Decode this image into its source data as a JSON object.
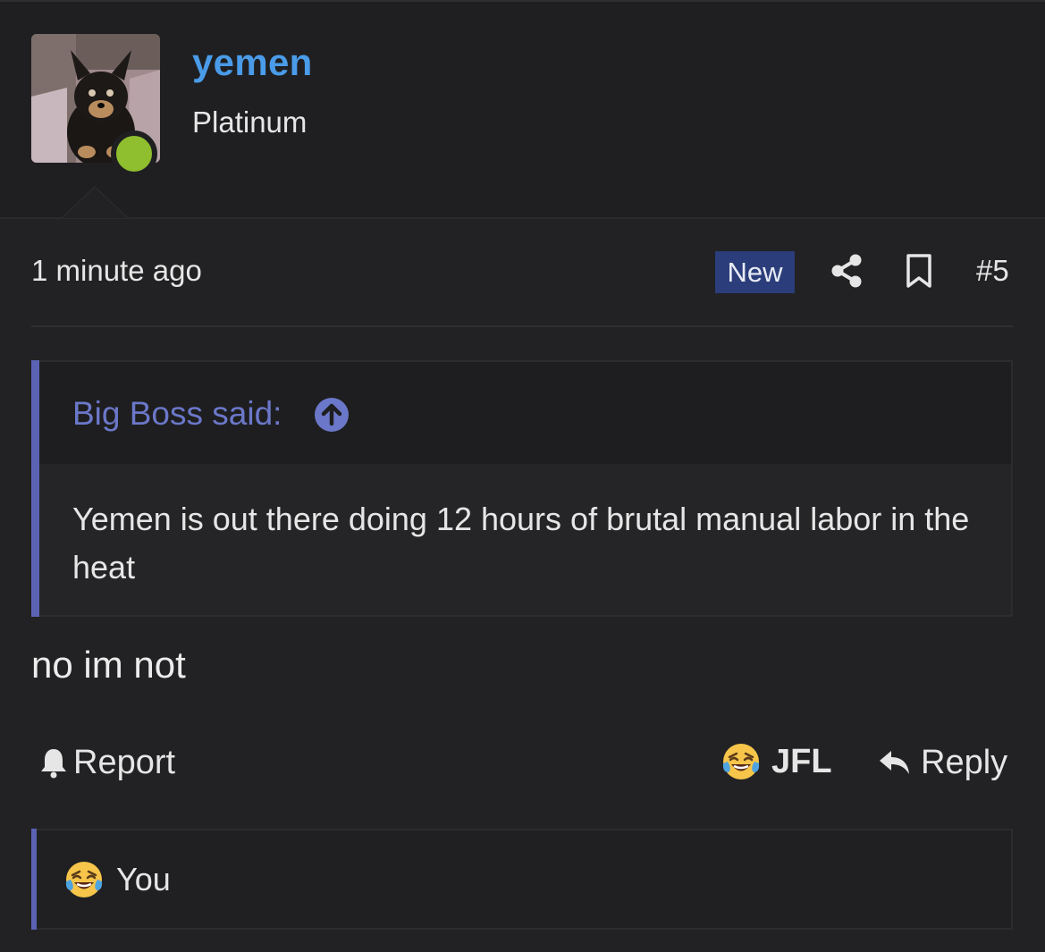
{
  "post": {
    "author": {
      "username": "yemen",
      "title": "Platinum",
      "avatar": "dog-avatar",
      "online": true
    },
    "timestamp": "1 minute ago",
    "badge": "New",
    "post_number": "#5",
    "icons": {
      "share": "share-icon",
      "bookmark": "bookmark-icon"
    },
    "quote": {
      "author_line": "Big Boss said:",
      "jump_icon": "arrow-up-circle-icon",
      "text": "Yemen is out there doing 12 hours of brutal manual labor in the heat"
    },
    "message": "no im not",
    "actions": {
      "report": "Report",
      "reaction": "JFL",
      "reply": "Reply"
    },
    "reactions_summary": {
      "emoji": "laughing-crying-emoji",
      "who": "You"
    }
  },
  "colors": {
    "background": "#222224",
    "username": "#4a9be8",
    "quote_accent": "#5b62b3",
    "quote_author": "#6b78c9",
    "badge_bg": "#2b3d7a",
    "online": "#8fbf2e"
  }
}
